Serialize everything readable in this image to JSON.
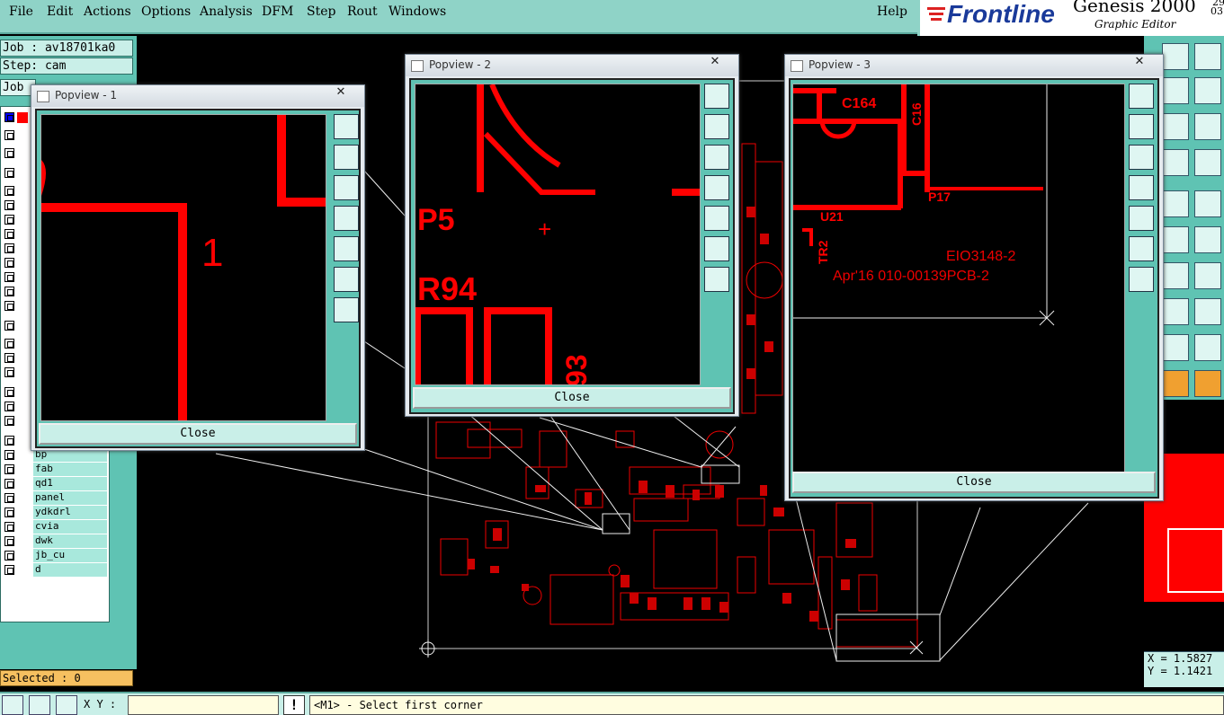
{
  "menubar": {
    "items": [
      "File",
      "Edit",
      "Actions",
      "Options",
      "Analysis",
      "DFM",
      "Step",
      "Rout",
      "Windows"
    ],
    "help": "Help"
  },
  "brand": {
    "logo": "Frontline",
    "product": "Genesis 2000",
    "subtitle": "Graphic Editor",
    "version_top": "29",
    "version_bottom": "03"
  },
  "leftpanel": {
    "job": "Job : av18701ka0",
    "step": "Step: cam",
    "job_tab": "Job",
    "layers": [
      "bp",
      "fab",
      "qd1",
      "panel",
      "ydkdrl",
      "cvia",
      "dwk",
      "jb_cu",
      "d"
    ],
    "selected": "Selected : 0"
  },
  "statusbar": {
    "xy_label": "X Y :",
    "warn": "!",
    "prompt": "<M1> - Select first corner"
  },
  "coords": {
    "x": "X = 1.5827",
    "y": "Y = 1.1421"
  },
  "popups": [
    {
      "title": "Popview - 1",
      "close": "Close",
      "x_glyph": "✕"
    },
    {
      "title": "Popview - 2",
      "close": "Close",
      "x_glyph": "✕"
    },
    {
      "title": "Popview - 3",
      "close": "Close",
      "x_glyph": "✕"
    }
  ],
  "board_text": {
    "p5": "P5",
    "r94": "R94",
    "n93": "93",
    "n1": "1",
    "c164": "C164",
    "c16": "C16",
    "p17": "P17",
    "u21": "U21",
    "tr2": "TR2",
    "eio": "EIO3148-2",
    "apr": "Apr'16  010-00139PCB-2"
  },
  "colors": {
    "teal": "#5fc3b3",
    "light_teal": "#c9efe8",
    "copper": "#ff0000"
  }
}
